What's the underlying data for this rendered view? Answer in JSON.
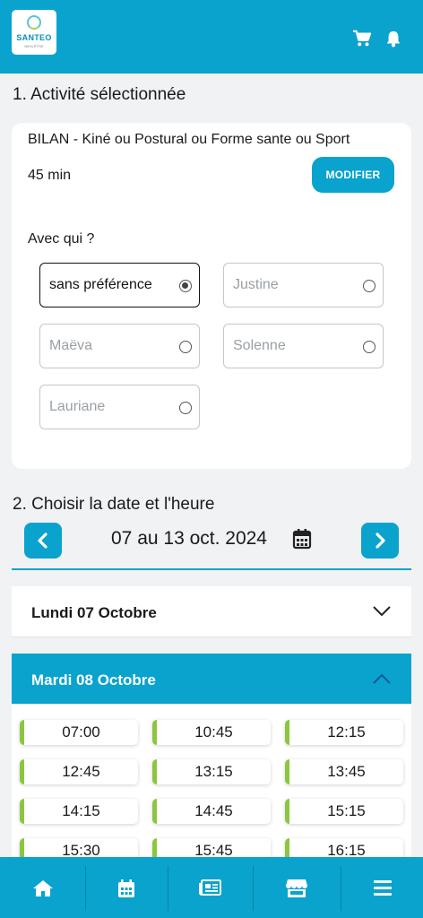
{
  "header": {
    "logo": {
      "brand": "SANTEO",
      "tagline": "BIEN-ÊTRE"
    },
    "cart_icon": "cart-icon",
    "bell_icon": "bell-icon",
    "color": "#09a3cd"
  },
  "section1": {
    "title": "1. Activité sélectionnée",
    "activity_name": "BILAN - Kiné ou Postural ou Forme sante ou Sport",
    "duration": "45 min",
    "modify_label": "MODIFIER",
    "with_label": "Avec qui ?",
    "practitioners": [
      {
        "label": "sans préférence",
        "selected": true
      },
      {
        "label": "Justine",
        "selected": false
      },
      {
        "label": "Maëva",
        "selected": false
      },
      {
        "label": "Solenne",
        "selected": false
      },
      {
        "label": "Lauriane",
        "selected": false
      }
    ]
  },
  "section2": {
    "title": "2. Choisir la date et l'heure",
    "week_label": "07 au 13 oct. 2024",
    "days": [
      {
        "label": "Lundi 07 Octobre",
        "expanded": false
      },
      {
        "label": "Mardi 08 Octobre",
        "expanded": true
      }
    ],
    "slots": [
      "07:00",
      "10:45",
      "12:15",
      "12:45",
      "13:15",
      "13:45",
      "14:15",
      "14:45",
      "15:15",
      "15:30",
      "15:45",
      "16:15"
    ],
    "slot_accent": "#8cc63f"
  },
  "bottom_nav": [
    "home-icon",
    "calendar-icon",
    "news-icon",
    "store-icon",
    "menu-icon"
  ]
}
